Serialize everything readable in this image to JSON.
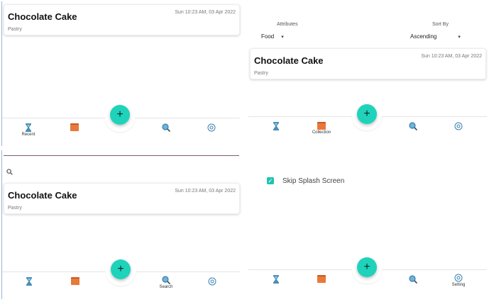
{
  "item": {
    "title": "Chocolate Cake",
    "date": "Sun 10:23 AM, 03 Apr 2022",
    "category": "Pastry"
  },
  "fab_label": "+",
  "nav": {
    "recent": "Recent",
    "collection": "Collection",
    "search": "Search",
    "setting": "Setting"
  },
  "collection_filters": {
    "attributes_label": "Attributes",
    "attributes_value": "Food",
    "sort_label": "Sort By",
    "sort_value": "Ascending"
  },
  "settings": {
    "skip_splash_label": "Skip Splash Screen",
    "skip_splash_checked": true
  },
  "colors": {
    "accent": "#1fd3bb",
    "hourglass": "#4a8fb8",
    "folder": "#e8793a",
    "search_icon": "#3b7fb0"
  },
  "icons": [
    "hourglass-icon",
    "folder-icon",
    "search-icon",
    "settings-icon",
    "add-icon",
    "dropdown-caret-icon",
    "checkbox-checked-icon"
  ]
}
